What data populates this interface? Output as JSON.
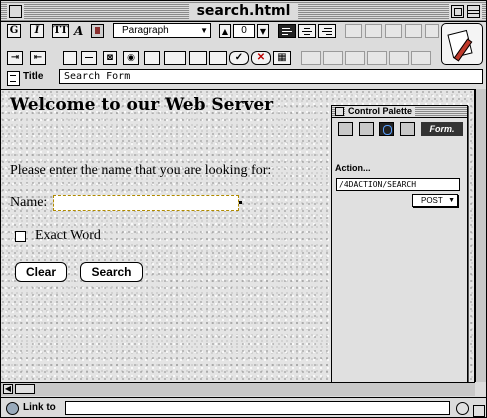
{
  "window": {
    "title": "search.html"
  },
  "toolbar": {
    "bold_label": "G",
    "italic_label": "I",
    "tt_label": "TT",
    "style_icon_label": "A",
    "paragraph_select": "Paragraph",
    "font_size_value": "0"
  },
  "title_row": {
    "label": "Title",
    "value": "Search Form"
  },
  "page": {
    "heading": "Welcome to our Web Server",
    "prompt": "Please enter the name that you are looking for:",
    "name_label": "Name:",
    "exact_word_label": "Exact Word",
    "clear_button": "Clear",
    "search_button": "Search"
  },
  "palette": {
    "title": "Control Palette",
    "form_tab": "Form.",
    "action_label": "Action...",
    "action_value": "/4DACTION/SEARCH",
    "method": "POST"
  },
  "status_bar": {
    "label": "Link to"
  }
}
